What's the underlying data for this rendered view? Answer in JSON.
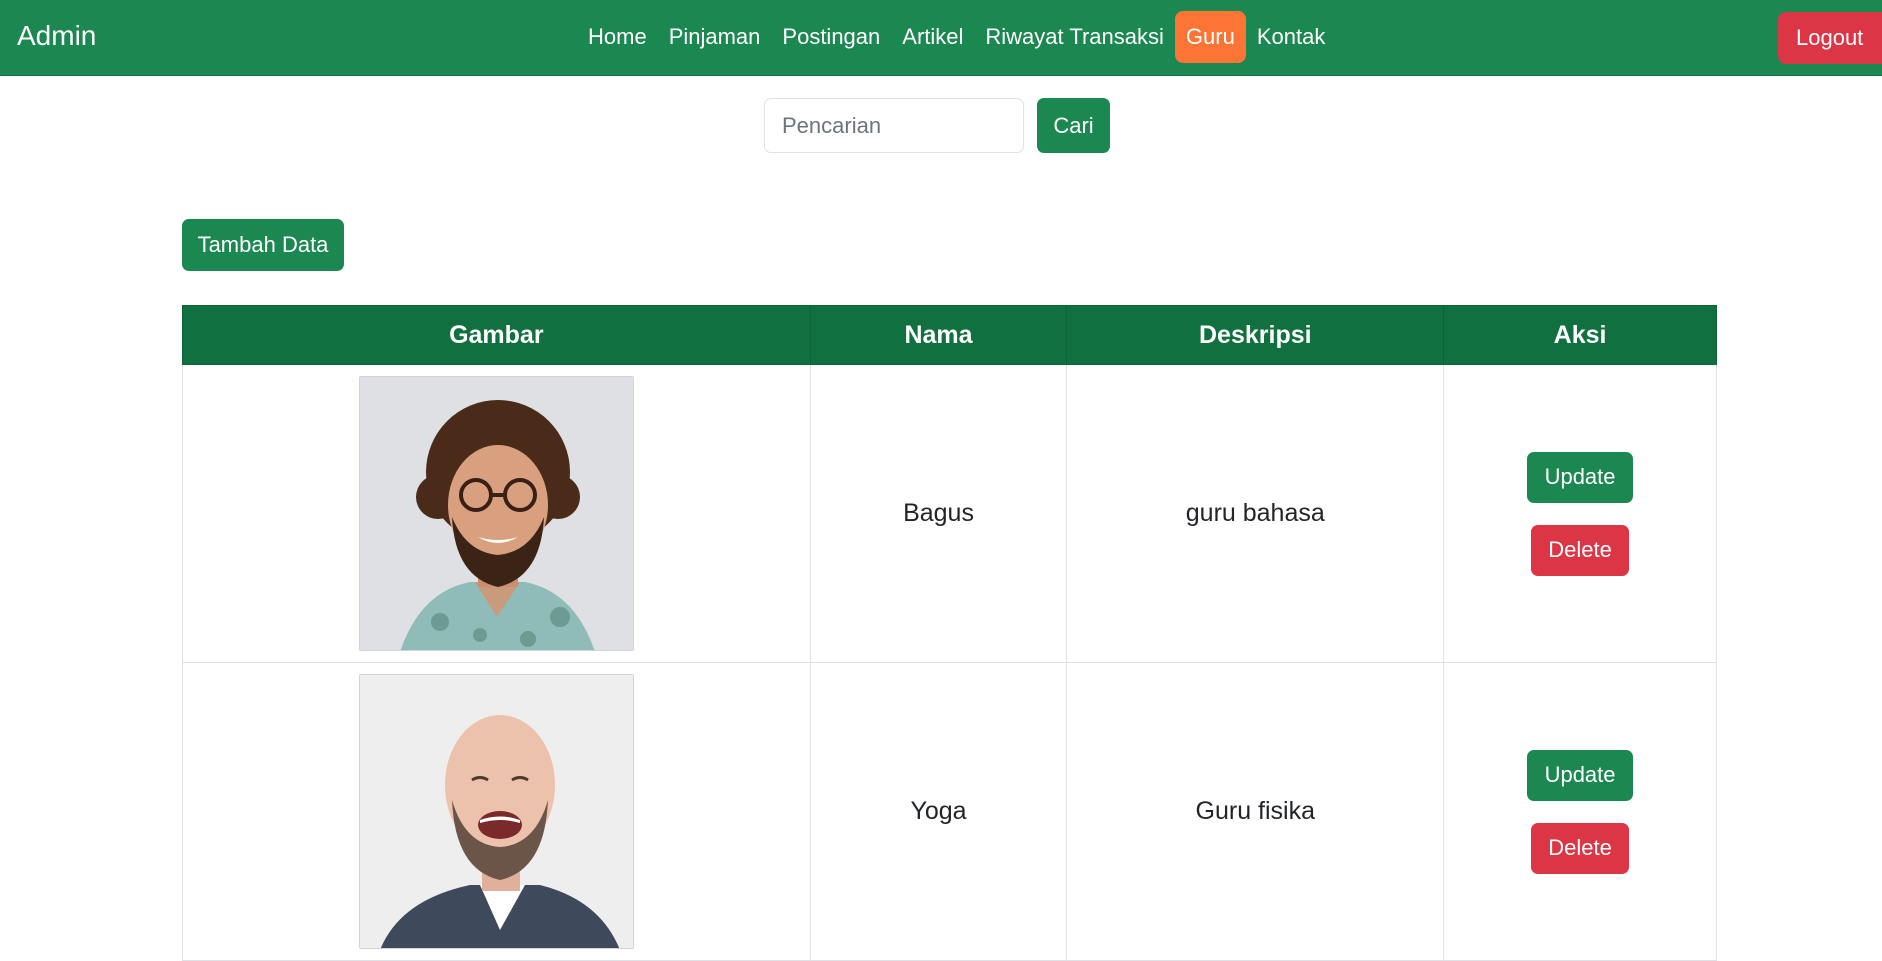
{
  "navbar": {
    "brand": "Admin",
    "active_color": "#fd7435",
    "links": [
      {
        "label": "Home"
      },
      {
        "label": "Pinjaman"
      },
      {
        "label": "Postingan"
      },
      {
        "label": "Artikel"
      },
      {
        "label": "Riwayat Transaksi"
      },
      {
        "label": "Guru",
        "active": true
      },
      {
        "label": "Kontak"
      }
    ],
    "logout_label": "Logout"
  },
  "search": {
    "placeholder": "Pencarian",
    "value": "",
    "button_label": "Cari"
  },
  "add_button_label": "Tambah Data",
  "table": {
    "headers": [
      "Gambar",
      "Nama",
      "Deskripsi",
      "Aksi"
    ],
    "rows": [
      {
        "photo": "teacher-photo-curly-hair-glasses",
        "name": "Bagus",
        "description": "guru bahasa",
        "update_label": "Update",
        "delete_label": "Delete"
      },
      {
        "photo": "teacher-photo-bald-beard-laughing",
        "name": "Yoga",
        "description": "Guru fisika",
        "update_label": "Update",
        "delete_label": "Delete"
      }
    ]
  },
  "colors": {
    "primary": "#1b8751",
    "header_bg": "#11703f",
    "danger": "#dc3545",
    "active_nav": "#fd7435"
  }
}
